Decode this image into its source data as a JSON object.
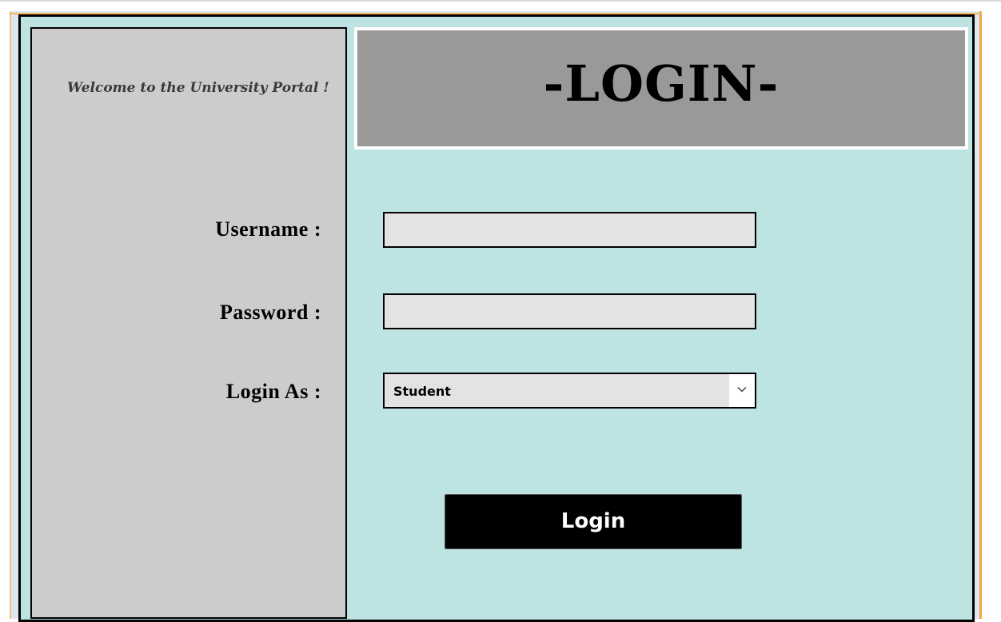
{
  "welcome_text": "Welcome to the University Portal !",
  "header": {
    "title": "-LOGIN-"
  },
  "form": {
    "username_label": "Username :",
    "username_value": "",
    "password_label": "Password :",
    "password_value": "",
    "login_as_label": "Login As :",
    "login_as_selected": "Student"
  },
  "button": {
    "login_label": "Login"
  },
  "icons": {
    "dropdown": "chevron-down-icon"
  },
  "colors": {
    "panel_background": "#bde3e3",
    "left_column": "#cccccc",
    "header_background": "#999999",
    "input_background": "#e3e3e3",
    "button_background": "#000000",
    "button_text": "#ffffff"
  }
}
